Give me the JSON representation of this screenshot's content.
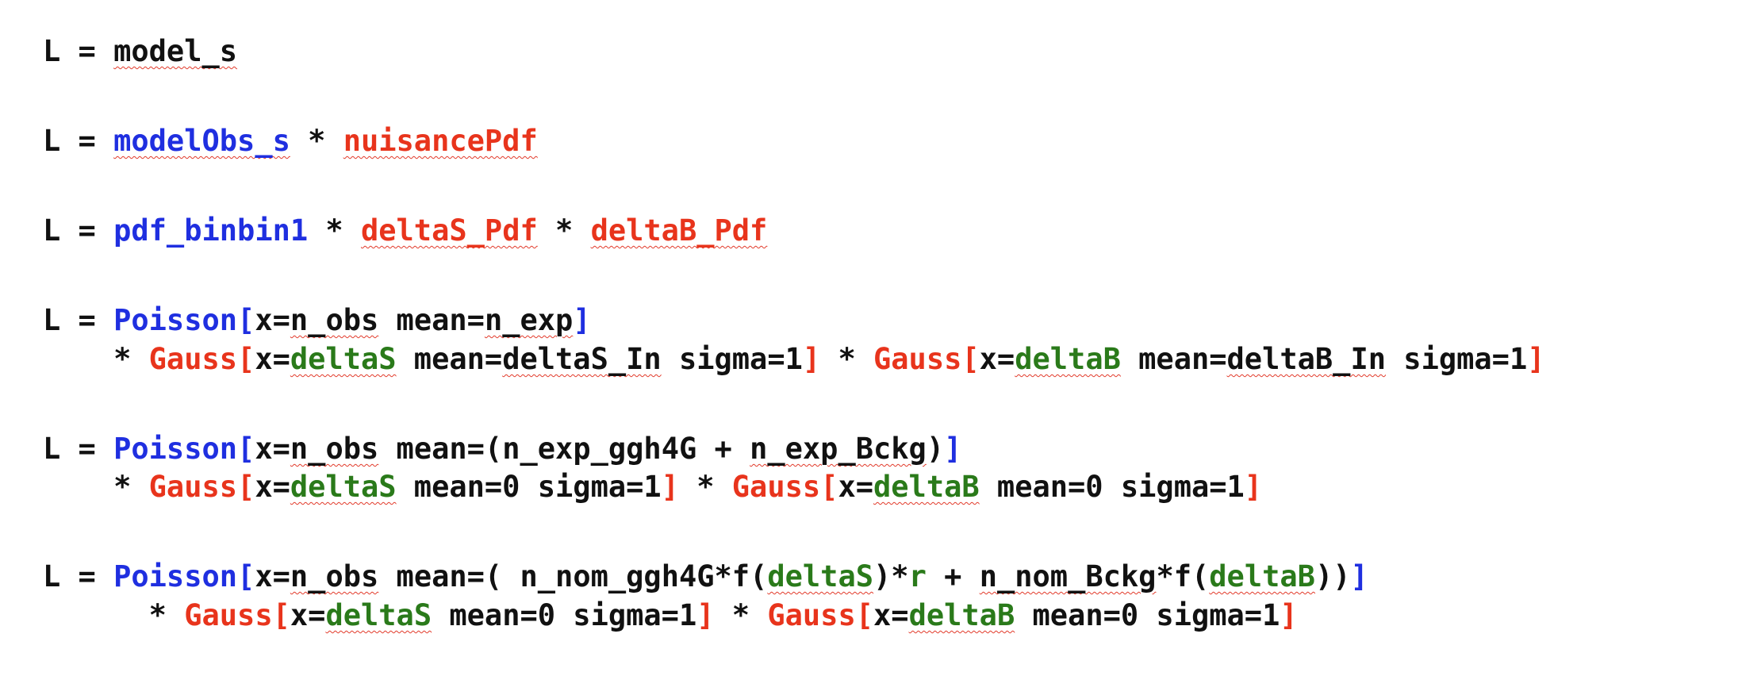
{
  "lines": [
    {
      "id": "eq1-line1",
      "tokens": [
        {
          "text": "L = ",
          "color": "black",
          "squiggle": false
        },
        {
          "text": "model_s",
          "color": "black",
          "squiggle": true
        }
      ]
    },
    {
      "id": "eq2-line1",
      "tokens": [
        {
          "text": "L = ",
          "color": "black",
          "squiggle": false
        },
        {
          "text": "modelObs_s",
          "color": "blue",
          "squiggle": true
        },
        {
          "text": " * ",
          "color": "black",
          "squiggle": false
        },
        {
          "text": "nuisancePdf",
          "color": "red",
          "squiggle": true
        }
      ]
    },
    {
      "id": "eq3-line1",
      "tokens": [
        {
          "text": "L = ",
          "color": "black",
          "squiggle": false
        },
        {
          "text": "pdf_binbin1",
          "color": "blue",
          "squiggle": false
        },
        {
          "text": " * ",
          "color": "black",
          "squiggle": false
        },
        {
          "text": "deltaS_Pdf",
          "color": "red",
          "squiggle": true
        },
        {
          "text": " * ",
          "color": "black",
          "squiggle": false
        },
        {
          "text": "deltaB_Pdf",
          "color": "red",
          "squiggle": true
        }
      ]
    },
    {
      "id": "eq4-line1",
      "tokens": [
        {
          "text": "L = ",
          "color": "black",
          "squiggle": false
        },
        {
          "text": "Poisson[",
          "color": "blue",
          "squiggle": false
        },
        {
          "text": "x=",
          "color": "black",
          "squiggle": false
        },
        {
          "text": "n_obs",
          "color": "black",
          "squiggle": true
        },
        {
          "text": " mean=",
          "color": "black",
          "squiggle": false
        },
        {
          "text": "n_exp",
          "color": "black",
          "squiggle": true
        },
        {
          "text": "]",
          "color": "blue",
          "squiggle": false
        }
      ]
    },
    {
      "id": "eq4-line2",
      "tokens": [
        {
          "text": "    * ",
          "color": "black",
          "squiggle": false
        },
        {
          "text": "Gauss[",
          "color": "red",
          "squiggle": false
        },
        {
          "text": "x=",
          "color": "black",
          "squiggle": false
        },
        {
          "text": "deltaS",
          "color": "green",
          "squiggle": true
        },
        {
          "text": " mean=",
          "color": "black",
          "squiggle": false
        },
        {
          "text": "deltaS_In",
          "color": "black",
          "squiggle": true
        },
        {
          "text": " sigma=1",
          "color": "black",
          "squiggle": false
        },
        {
          "text": "]",
          "color": "red",
          "squiggle": false
        },
        {
          "text": " * ",
          "color": "black",
          "squiggle": false
        },
        {
          "text": "Gauss[",
          "color": "red",
          "squiggle": false
        },
        {
          "text": "x=",
          "color": "black",
          "squiggle": false
        },
        {
          "text": "deltaB",
          "color": "green",
          "squiggle": true
        },
        {
          "text": " mean=",
          "color": "black",
          "squiggle": false
        },
        {
          "text": "deltaB_In",
          "color": "black",
          "squiggle": true
        },
        {
          "text": " sigma=1",
          "color": "black",
          "squiggle": false
        },
        {
          "text": "]",
          "color": "red",
          "squiggle": false
        }
      ]
    },
    {
      "id": "eq5-line1",
      "tokens": [
        {
          "text": "L = ",
          "color": "black",
          "squiggle": false
        },
        {
          "text": "Poisson[",
          "color": "blue",
          "squiggle": false
        },
        {
          "text": "x=",
          "color": "black",
          "squiggle": false
        },
        {
          "text": "n_obs",
          "color": "black",
          "squiggle": true
        },
        {
          "text": " mean=(n_exp_ggh4G + ",
          "color": "black",
          "squiggle": false
        },
        {
          "text": "n_exp_Bckg",
          "color": "black",
          "squiggle": true
        },
        {
          "text": ")",
          "color": "black",
          "squiggle": false
        },
        {
          "text": "]",
          "color": "blue",
          "squiggle": false
        }
      ]
    },
    {
      "id": "eq5-line2",
      "tokens": [
        {
          "text": "    * ",
          "color": "black",
          "squiggle": false
        },
        {
          "text": "Gauss[",
          "color": "red",
          "squiggle": false
        },
        {
          "text": "x=",
          "color": "black",
          "squiggle": false
        },
        {
          "text": "deltaS",
          "color": "green",
          "squiggle": true
        },
        {
          "text": " mean=0 sigma=1",
          "color": "black",
          "squiggle": false
        },
        {
          "text": "]",
          "color": "red",
          "squiggle": false
        },
        {
          "text": " * ",
          "color": "black",
          "squiggle": false
        },
        {
          "text": "Gauss[",
          "color": "red",
          "squiggle": false
        },
        {
          "text": "x=",
          "color": "black",
          "squiggle": false
        },
        {
          "text": "deltaB",
          "color": "green",
          "squiggle": true
        },
        {
          "text": " mean=0 sigma=1",
          "color": "black",
          "squiggle": false
        },
        {
          "text": "]",
          "color": "red",
          "squiggle": false
        }
      ]
    },
    {
      "id": "eq6-line1",
      "tokens": [
        {
          "text": "L = ",
          "color": "black",
          "squiggle": false
        },
        {
          "text": "Poisson[",
          "color": "blue",
          "squiggle": false
        },
        {
          "text": "x=",
          "color": "black",
          "squiggle": false
        },
        {
          "text": "n_obs",
          "color": "black",
          "squiggle": true
        },
        {
          "text": " mean=( n_nom_ggh4G*f(",
          "color": "black",
          "squiggle": false
        },
        {
          "text": "deltaS",
          "color": "green",
          "squiggle": true
        },
        {
          "text": ")*",
          "color": "black",
          "squiggle": false
        },
        {
          "text": "r",
          "color": "green",
          "squiggle": false
        },
        {
          "text": " + ",
          "color": "black",
          "squiggle": false
        },
        {
          "text": "n_nom_Bckg",
          "color": "black",
          "squiggle": true
        },
        {
          "text": "*f(",
          "color": "black",
          "squiggle": false
        },
        {
          "text": "deltaB",
          "color": "green",
          "squiggle": true
        },
        {
          "text": "))",
          "color": "black",
          "squiggle": false
        },
        {
          "text": "]",
          "color": "blue",
          "squiggle": false
        }
      ]
    },
    {
      "id": "eq6-line2",
      "tokens": [
        {
          "text": "      * ",
          "color": "black",
          "squiggle": false
        },
        {
          "text": "Gauss[",
          "color": "red",
          "squiggle": false
        },
        {
          "text": "x=",
          "color": "black",
          "squiggle": false
        },
        {
          "text": "deltaS",
          "color": "green",
          "squiggle": true
        },
        {
          "text": " mean=0 sigma=1",
          "color": "black",
          "squiggle": false
        },
        {
          "text": "]",
          "color": "red",
          "squiggle": false
        },
        {
          "text": " * ",
          "color": "black",
          "squiggle": false
        },
        {
          "text": "Gauss[",
          "color": "red",
          "squiggle": false
        },
        {
          "text": "x=",
          "color": "black",
          "squiggle": false
        },
        {
          "text": "deltaB",
          "color": "green",
          "squiggle": true
        },
        {
          "text": " mean=0 sigma=1",
          "color": "black",
          "squiggle": false
        },
        {
          "text": "]",
          "color": "red",
          "squiggle": false
        }
      ]
    }
  ]
}
